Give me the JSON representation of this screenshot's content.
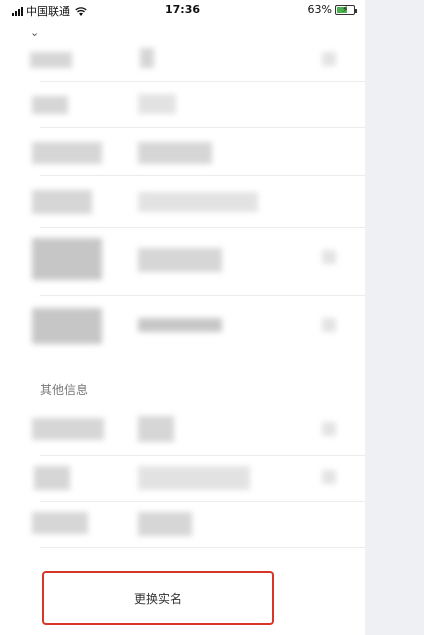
{
  "status_bar": {
    "carrier": "中国联通",
    "time": "17:36",
    "battery_percent": "63%",
    "battery_level": 0.63
  },
  "section": {
    "other_info_title": "其他信息"
  },
  "actions": {
    "change_realname_label": "更换实名"
  },
  "colors": {
    "accent_border": "#d9362b",
    "battery_green": "#4caf50"
  }
}
